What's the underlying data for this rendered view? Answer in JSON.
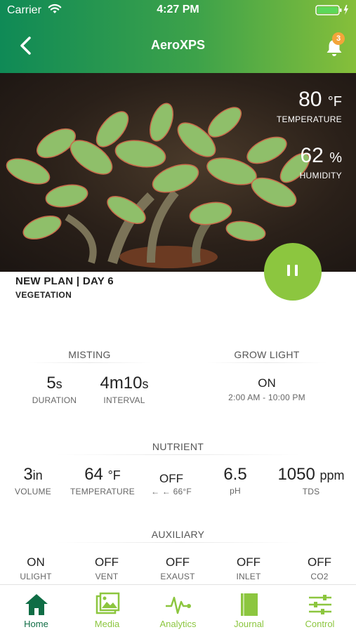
{
  "status_bar": {
    "carrier": "Carrier",
    "time": "4:27 PM"
  },
  "nav": {
    "title": "AeroXPS",
    "notification_count": "3"
  },
  "hero": {
    "temperature": {
      "value": "80",
      "unit": "°F",
      "label": "TEMPERATURE"
    },
    "humidity": {
      "value": "62",
      "unit": "%",
      "label": "HUMIDITY"
    }
  },
  "plan": {
    "title": "NEW PLAN | DAY 6",
    "stage": "VEGETATION"
  },
  "misting": {
    "heading": "MISTING",
    "duration": {
      "value": "5",
      "unit": "s",
      "label": "DURATION"
    },
    "interval": {
      "value": "4m10",
      "unit": "s",
      "label": "INTERVAL"
    }
  },
  "grow_light": {
    "heading": "GROW LIGHT",
    "state": "ON",
    "schedule": "2:00 AM - 10:00 PM"
  },
  "nutrient": {
    "heading": "NUTRIENT",
    "volume": {
      "value": "3",
      "unit": "in",
      "label": "VOLUME"
    },
    "temperature": {
      "value": "64",
      "unit": "°F",
      "label": "TEMPERATURE"
    },
    "heater": {
      "state": "OFF",
      "detail": "← ← 66°F"
    },
    "ph": {
      "value": "6.5",
      "label": "pH"
    },
    "tds": {
      "value": "1050",
      "unit": "ppm",
      "label": "TDS"
    }
  },
  "auxiliary": {
    "heading": "AUXILIARY",
    "items": [
      {
        "state": "ON",
        "label": "ULIGHT"
      },
      {
        "state": "OFF",
        "label": "VENT"
      },
      {
        "state": "OFF",
        "label": "EXAUST"
      },
      {
        "state": "OFF",
        "label": "INLET"
      },
      {
        "state": "OFF",
        "label": "CO2"
      }
    ]
  },
  "tabs": [
    {
      "label": "Home",
      "icon": "home-icon",
      "active": true
    },
    {
      "label": "Media",
      "icon": "media-icon",
      "active": false
    },
    {
      "label": "Analytics",
      "icon": "analytics-icon",
      "active": false
    },
    {
      "label": "Journal",
      "icon": "journal-icon",
      "active": false
    },
    {
      "label": "Control",
      "icon": "control-icon",
      "active": false
    }
  ],
  "colors": {
    "header_start": "#0f8a56",
    "header_end": "#86bf3a",
    "accent": "#8cc63f",
    "tab_active": "#0f6d45",
    "badge": "#f3a53a"
  }
}
